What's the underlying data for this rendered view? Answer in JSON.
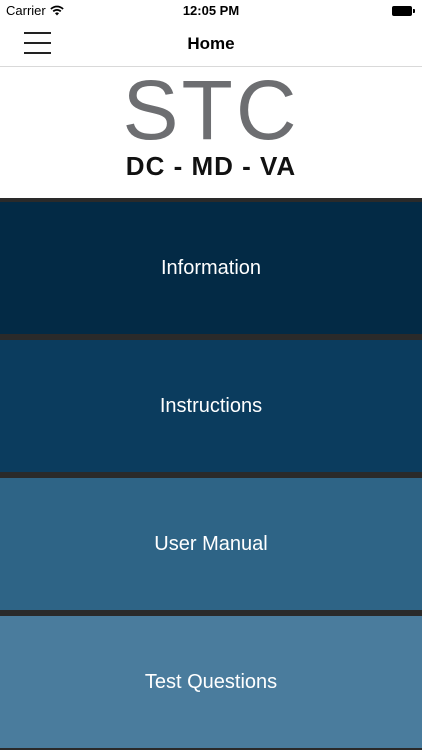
{
  "status_bar": {
    "carrier": "Carrier",
    "time": "12:05 PM",
    "wifi_icon": "wifi-icon",
    "battery_icon": "battery-icon"
  },
  "nav": {
    "title": "Home",
    "menu_icon": "hamburger-menu-icon"
  },
  "logo": {
    "main": "STC",
    "sub": "DC - MD - VA"
  },
  "menu": {
    "items": [
      {
        "label": "Information",
        "color": "#032a45"
      },
      {
        "label": "Instructions",
        "color": "#0b3c5e"
      },
      {
        "label": "User Manual",
        "color": "#2e6486"
      },
      {
        "label": "Test Questions",
        "color": "#4a7c9d"
      }
    ]
  }
}
